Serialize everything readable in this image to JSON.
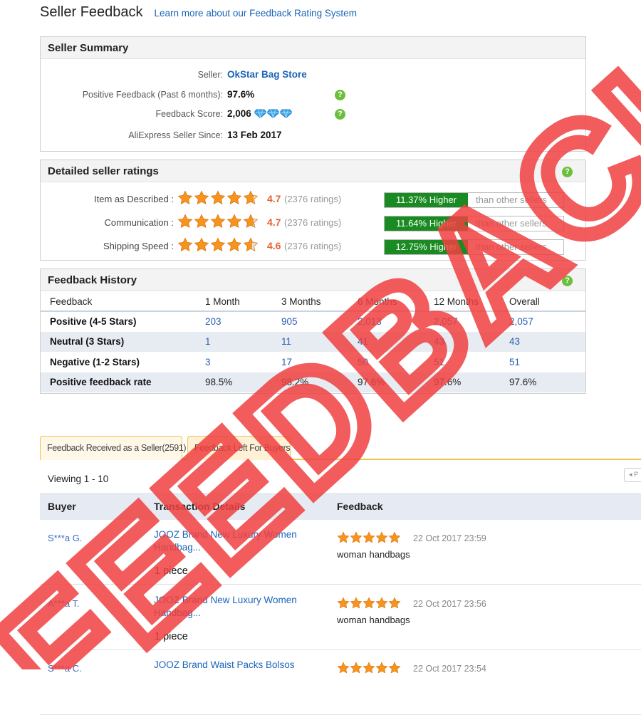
{
  "header": {
    "title": "Seller Feedback",
    "learn_link": "Learn more about our Feedback Rating System"
  },
  "summary": {
    "heading": "Seller Summary",
    "seller_label": "Seller:",
    "seller_name": "OkStar Bag Store",
    "positive_label": "Positive Feedback (Past 6 months):",
    "positive_value": "97.6%",
    "score_label": "Feedback Score:",
    "score_value": "2,006",
    "score_badge_icon": "diamond-icon",
    "score_badge_count": 3,
    "since_label": "AliExpress Seller Since:",
    "since_value": "13 Feb 2017"
  },
  "ratings": {
    "heading": "Detailed seller ratings",
    "comparison_suffix": "than other sellers",
    "items": [
      {
        "label": "Item as Described :",
        "score": "4.7",
        "count": "(2376 ratings)",
        "stars": 4.7,
        "comparison": "11.37% Higher"
      },
      {
        "label": "Communication :",
        "score": "4.7",
        "count": "(2376 ratings)",
        "stars": 4.7,
        "comparison": "11.64% Higher"
      },
      {
        "label": "Shipping Speed :",
        "score": "4.6",
        "count": "(2376 ratings)",
        "stars": 4.6,
        "comparison": "12.75% Higher"
      }
    ]
  },
  "history": {
    "heading": "Feedback History",
    "columns": [
      "Feedback",
      "1 Month",
      "3 Months",
      "6 Months",
      "12 Months",
      "Overall"
    ],
    "rows": [
      {
        "label": "Positive (4-5 Stars)",
        "values": [
          "203",
          "905",
          "2,013",
          "2,057",
          "2,057"
        ]
      },
      {
        "label": "Neutral (3 Stars)",
        "values": [
          "1",
          "11",
          "41",
          "43",
          "43"
        ]
      },
      {
        "label": "Negative (1-2 Stars)",
        "values": [
          "3",
          "17",
          "50",
          "51",
          "51"
        ]
      },
      {
        "label": "Positive feedback rate",
        "values": [
          "98.5%",
          "98.2%",
          "97.6%",
          "97.6%",
          "97.6%"
        ]
      }
    ]
  },
  "tabs": {
    "received": "Feedback Received as a Seller(2591)",
    "left": "Feedback Left For Buyers"
  },
  "list": {
    "viewing": "Viewing 1 - 10",
    "pager_label": "◂ P",
    "headers": {
      "buyer": "Buyer",
      "transaction": "Transaction Details",
      "feedback": "Feedback"
    },
    "entries": [
      {
        "buyer": "S***a G.",
        "product": "JOOZ Brand New Luxury Women Handbag...",
        "qty": "1 piece",
        "stars": 5,
        "date": "22 Oct 2017 23:59",
        "text": "woman handbags"
      },
      {
        "buyer": "A***a T.",
        "product": "JOOZ Brand New Luxury Women Handbag...",
        "qty": "1 piece",
        "stars": 5,
        "date": "22 Oct 2017 23:56",
        "text": "woman handbags"
      },
      {
        "buyer": "S***a C.",
        "product": "JOOZ Brand Waist Packs Bolsos",
        "qty": "",
        "stars": 5,
        "date": "22 Oct 2017 23:54",
        "text": ""
      }
    ]
  },
  "watermark": {
    "text": "FEEDBACK",
    "color": "#f04040"
  },
  "colors": {
    "accent_green": "#1a8b22",
    "star_orange": "#f7941d",
    "link_blue": "#1a64b8",
    "score_orange": "#e7622d"
  }
}
